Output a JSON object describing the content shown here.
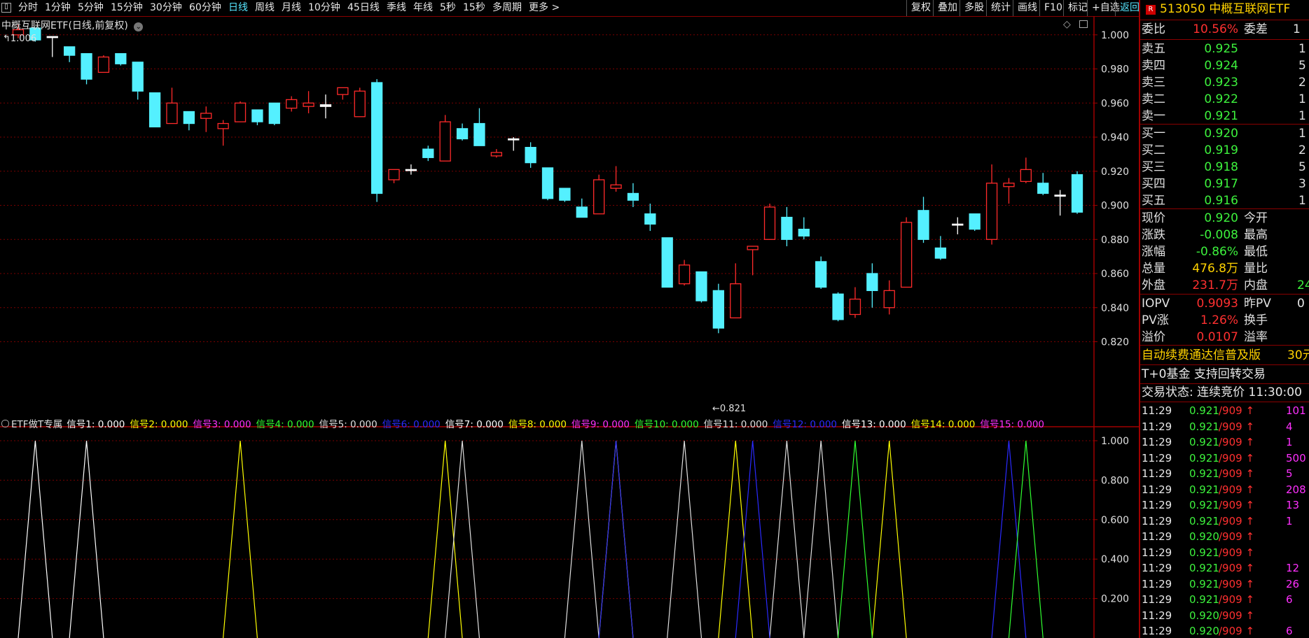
{
  "toolbar": {
    "periods": [
      "分时",
      "1分钟",
      "5分钟",
      "15分钟",
      "30分钟",
      "60分钟",
      "日线",
      "周线",
      "月线",
      "10分钟",
      "45日线",
      "季线",
      "年线",
      "5秒",
      "15秒",
      "多周期",
      "更多 >"
    ],
    "active_period": "日线",
    "right_buttons": [
      "复权",
      "叠加",
      "多股",
      "统计",
      "画线",
      "F10",
      "标记",
      "+自选",
      "返回"
    ]
  },
  "main_chart": {
    "title": "中概互联网ETF(日线,前复权)",
    "high_label": "1.006",
    "low_label": "0.821",
    "y_ticks": [
      "1.000",
      "0.980",
      "0.960",
      "0.940",
      "0.920",
      "0.900",
      "0.880",
      "0.860",
      "0.840",
      "0.820"
    ],
    "colors": {
      "up": "#ff2a2a",
      "down": "#54f0ff",
      "grid": "#7a0000"
    }
  },
  "indicator": {
    "name": "ETF做T专属",
    "signals": [
      {
        "label": "信号1: 0.000",
        "color": "#ffffff"
      },
      {
        "label": "信号2: 0.000",
        "color": "#ffff00"
      },
      {
        "label": "信号3: 0.000",
        "color": "#ff30ff"
      },
      {
        "label": "信号4: 0.000",
        "color": "#30ff30"
      },
      {
        "label": "信号5: 0.000",
        "color": "#e0e0e0"
      },
      {
        "label": "信号6: 0.000",
        "color": "#2a2aff"
      },
      {
        "label": "信号7: 0.000",
        "color": "#ffffff"
      },
      {
        "label": "信号8: 0.000",
        "color": "#ffff00"
      },
      {
        "label": "信号9: 0.000",
        "color": "#ff30ff"
      },
      {
        "label": "信号10: 0.000",
        "color": "#30ff30"
      },
      {
        "label": "信号11: 0.000",
        "color": "#e0e0e0"
      },
      {
        "label": "信号12: 0.000",
        "color": "#2a2aff"
      },
      {
        "label": "信号13: 0.000",
        "color": "#ffffff"
      },
      {
        "label": "信号14: 0.000",
        "color": "#ffff00"
      },
      {
        "label": "信号15: 0.000",
        "color": "#ff30ff"
      }
    ],
    "y_ticks": [
      "1.000",
      "0.800",
      "0.600",
      "0.400",
      "0.200"
    ]
  },
  "chart_data": [
    {
      "type": "candlestick",
      "title": "中概互联网ETF(日线,前复权)",
      "ylim": [
        0.812,
        1.011
      ],
      "series": [
        {
          "o": 1.0,
          "h": 1.006,
          "l": 0.998,
          "c": 1.003
        },
        {
          "o": 1.004,
          "h": 1.004,
          "l": 0.996,
          "c": 0.997
        },
        {
          "o": 0.999,
          "h": 0.999,
          "l": 0.987,
          "c": 0.999
        },
        {
          "o": 0.993,
          "h": 0.993,
          "l": 0.984,
          "c": 0.988
        },
        {
          "o": 0.989,
          "h": 0.989,
          "l": 0.971,
          "c": 0.974
        },
        {
          "o": 0.978,
          "h": 0.988,
          "l": 0.978,
          "c": 0.987
        },
        {
          "o": 0.989,
          "h": 0.989,
          "l": 0.982,
          "c": 0.983
        },
        {
          "o": 0.984,
          "h": 0.984,
          "l": 0.962,
          "c": 0.967
        },
        {
          "o": 0.966,
          "h": 0.966,
          "l": 0.946,
          "c": 0.946
        },
        {
          "o": 0.948,
          "h": 0.969,
          "l": 0.948,
          "c": 0.96
        },
        {
          "o": 0.955,
          "h": 0.955,
          "l": 0.944,
          "c": 0.948
        },
        {
          "o": 0.951,
          "h": 0.958,
          "l": 0.943,
          "c": 0.954
        },
        {
          "o": 0.945,
          "h": 0.95,
          "l": 0.935,
          "c": 0.948
        },
        {
          "o": 0.949,
          "h": 0.961,
          "l": 0.949,
          "c": 0.96
        },
        {
          "o": 0.956,
          "h": 0.956,
          "l": 0.947,
          "c": 0.949
        },
        {
          "o": 0.96,
          "h": 0.96,
          "l": 0.947,
          "c": 0.948
        },
        {
          "o": 0.957,
          "h": 0.964,
          "l": 0.955,
          "c": 0.962
        },
        {
          "o": 0.958,
          "h": 0.967,
          "l": 0.954,
          "c": 0.96
        },
        {
          "o": 0.958,
          "h": 0.965,
          "l": 0.951,
          "c": 0.959
        },
        {
          "o": 0.965,
          "h": 0.969,
          "l": 0.962,
          "c": 0.969
        },
        {
          "o": 0.952,
          "h": 0.969,
          "l": 0.952,
          "c": 0.967
        },
        {
          "o": 0.972,
          "h": 0.974,
          "l": 0.902,
          "c": 0.907
        },
        {
          "o": 0.915,
          "h": 0.921,
          "l": 0.913,
          "c": 0.921
        },
        {
          "o": 0.921,
          "h": 0.924,
          "l": 0.918,
          "c": 0.921
        },
        {
          "o": 0.933,
          "h": 0.935,
          "l": 0.926,
          "c": 0.928
        },
        {
          "o": 0.926,
          "h": 0.953,
          "l": 0.926,
          "c": 0.949
        },
        {
          "o": 0.945,
          "h": 0.948,
          "l": 0.938,
          "c": 0.939
        },
        {
          "o": 0.948,
          "h": 0.957,
          "l": 0.935,
          "c": 0.935
        },
        {
          "o": 0.929,
          "h": 0.933,
          "l": 0.928,
          "c": 0.931
        },
        {
          "o": 0.939,
          "h": 0.94,
          "l": 0.932,
          "c": 0.939
        },
        {
          "o": 0.934,
          "h": 0.937,
          "l": 0.922,
          "c": 0.925
        },
        {
          "o": 0.922,
          "h": 0.922,
          "l": 0.903,
          "c": 0.904
        },
        {
          "o": 0.91,
          "h": 0.91,
          "l": 0.902,
          "c": 0.903
        },
        {
          "o": 0.899,
          "h": 0.904,
          "l": 0.893,
          "c": 0.893
        },
        {
          "o": 0.895,
          "h": 0.918,
          "l": 0.895,
          "c": 0.915
        },
        {
          "o": 0.91,
          "h": 0.923,
          "l": 0.908,
          "c": 0.912
        },
        {
          "o": 0.907,
          "h": 0.913,
          "l": 0.899,
          "c": 0.903
        },
        {
          "o": 0.895,
          "h": 0.901,
          "l": 0.885,
          "c": 0.889
        },
        {
          "o": 0.881,
          "h": 0.881,
          "l": 0.852,
          "c": 0.852
        },
        {
          "o": 0.854,
          "h": 0.868,
          "l": 0.853,
          "c": 0.865
        },
        {
          "o": 0.861,
          "h": 0.861,
          "l": 0.843,
          "c": 0.844
        },
        {
          "o": 0.85,
          "h": 0.854,
          "l": 0.825,
          "c": 0.828
        },
        {
          "o": 0.834,
          "h": 0.866,
          "l": 0.834,
          "c": 0.854
        },
        {
          "o": 0.874,
          "h": 0.876,
          "l": 0.859,
          "c": 0.876
        },
        {
          "o": 0.88,
          "h": 0.901,
          "l": 0.88,
          "c": 0.899
        },
        {
          "o": 0.893,
          "h": 0.899,
          "l": 0.876,
          "c": 0.88
        },
        {
          "o": 0.886,
          "h": 0.893,
          "l": 0.88,
          "c": 0.882
        },
        {
          "o": 0.867,
          "h": 0.87,
          "l": 0.851,
          "c": 0.852
        },
        {
          "o": 0.848,
          "h": 0.849,
          "l": 0.832,
          "c": 0.833
        },
        {
          "o": 0.836,
          "h": 0.852,
          "l": 0.834,
          "c": 0.845
        },
        {
          "o": 0.86,
          "h": 0.866,
          "l": 0.84,
          "c": 0.85
        },
        {
          "o": 0.84,
          "h": 0.856,
          "l": 0.836,
          "c": 0.85
        },
        {
          "o": 0.852,
          "h": 0.893,
          "l": 0.852,
          "c": 0.89
        },
        {
          "o": 0.897,
          "h": 0.905,
          "l": 0.878,
          "c": 0.88
        },
        {
          "o": 0.875,
          "h": 0.882,
          "l": 0.868,
          "c": 0.869
        },
        {
          "o": 0.889,
          "h": 0.893,
          "l": 0.883,
          "c": 0.889
        },
        {
          "o": 0.895,
          "h": 0.895,
          "l": 0.885,
          "c": 0.886
        },
        {
          "o": 0.88,
          "h": 0.924,
          "l": 0.877,
          "c": 0.913
        },
        {
          "o": 0.911,
          "h": 0.916,
          "l": 0.901,
          "c": 0.913
        },
        {
          "o": 0.914,
          "h": 0.928,
          "l": 0.913,
          "c": 0.921
        },
        {
          "o": 0.913,
          "h": 0.919,
          "l": 0.906,
          "c": 0.907
        },
        {
          "o": 0.906,
          "h": 0.909,
          "l": 0.894,
          "c": 0.906
        },
        {
          "o": 0.918,
          "h": 0.92,
          "l": 0.895,
          "c": 0.896
        }
      ]
    },
    {
      "type": "line",
      "title": "ETF做T专属",
      "ylim": [
        0,
        1
      ],
      "series": [
        {
          "color": "#ffffff",
          "x": [
            1,
            4
          ]
        },
        {
          "color": "#ffff00",
          "x": [
            13,
            25,
            35,
            42,
            51
          ]
        },
        {
          "color": "#e0e0e0",
          "x": [
            26,
            33,
            39,
            45,
            47
          ]
        },
        {
          "color": "#2a2aff",
          "x": [
            35,
            43,
            58
          ]
        },
        {
          "color": "#30ff30",
          "x": [
            49,
            59
          ]
        }
      ]
    }
  ],
  "right_panel": {
    "code": "513050",
    "name": "中概互联网ETF",
    "weibi_label": "委比",
    "weibi_value": "10.56%",
    "weicha_label": "委差",
    "weicha_value": "1",
    "sells": [
      {
        "label": "卖五",
        "price": "0.925",
        "vol": "1"
      },
      {
        "label": "卖四",
        "price": "0.924",
        "vol": "5"
      },
      {
        "label": "卖三",
        "price": "0.923",
        "vol": "2"
      },
      {
        "label": "卖二",
        "price": "0.922",
        "vol": "1"
      },
      {
        "label": "卖一",
        "price": "0.921",
        "vol": "1"
      }
    ],
    "buys": [
      {
        "label": "买一",
        "price": "0.920",
        "vol": "1"
      },
      {
        "label": "买二",
        "price": "0.919",
        "vol": "2"
      },
      {
        "label": "买三",
        "price": "0.918",
        "vol": "5"
      },
      {
        "label": "买四",
        "price": "0.917",
        "vol": "3"
      },
      {
        "label": "买五",
        "price": "0.916",
        "vol": "1"
      }
    ],
    "stats": [
      {
        "l1": "现价",
        "v1": "0.920",
        "c1": "g",
        "l2": "今开",
        "v2": ""
      },
      {
        "l1": "涨跌",
        "v1": "-0.008",
        "c1": "g",
        "l2": "最高",
        "v2": ""
      },
      {
        "l1": "涨幅",
        "v1": "-0.86%",
        "c1": "g",
        "l2": "最低",
        "v2": ""
      },
      {
        "l1": "总量",
        "v1": "476.8万",
        "c1": "y",
        "l2": "量比",
        "v2": ""
      },
      {
        "l1": "外盘",
        "v1": "231.7万",
        "c1": "r",
        "l2": "内盘",
        "v2": "24"
      }
    ],
    "stats2": [
      {
        "l1": "IOPV",
        "v1": "0.9093",
        "c1": "r",
        "l2": "昨PV",
        "v2": "0"
      },
      {
        "l1": "PV涨",
        "v1": "1.26%",
        "c1": "r",
        "l2": "换手",
        "v2": ""
      },
      {
        "l1": "溢价",
        "v1": "0.0107",
        "c1": "r",
        "l2": "溢率",
        "v2": ""
      }
    ],
    "ad_text": "自动续费通达信普及版",
    "ad_price": "30元",
    "t0_text": "T+0基金 支持回转交易",
    "status_text": "交易状态: 连续竞价 11:30:00",
    "ticks": [
      {
        "t": "11:29",
        "p": "0.921",
        "s": "/909",
        "v": "101"
      },
      {
        "t": "11:29",
        "p": "0.921",
        "s": "/909",
        "v": "4"
      },
      {
        "t": "11:29",
        "p": "0.921",
        "s": "/909",
        "v": "1"
      },
      {
        "t": "11:29",
        "p": "0.921",
        "s": "/909",
        "v": "500"
      },
      {
        "t": "11:29",
        "p": "0.921",
        "s": "/909",
        "v": "5"
      },
      {
        "t": "11:29",
        "p": "0.921",
        "s": "/909",
        "v": "208"
      },
      {
        "t": "11:29",
        "p": "0.921",
        "s": "/909",
        "v": "13"
      },
      {
        "t": "11:29",
        "p": "0.921",
        "s": "/909",
        "v": "1"
      },
      {
        "t": "11:29",
        "p": "0.920",
        "s": "/909",
        "v": ""
      },
      {
        "t": "11:29",
        "p": "0.921",
        "s": "/909",
        "v": ""
      },
      {
        "t": "11:29",
        "p": "0.921",
        "s": "/909",
        "v": "12"
      },
      {
        "t": "11:29",
        "p": "0.921",
        "s": "/909",
        "v": "26"
      },
      {
        "t": "11:29",
        "p": "0.921",
        "s": "/909",
        "v": "6"
      },
      {
        "t": "11:29",
        "p": "0.920",
        "s": "/909",
        "v": ""
      },
      {
        "t": "11:29",
        "p": "0.920",
        "s": "/909",
        "v": "6"
      }
    ]
  }
}
